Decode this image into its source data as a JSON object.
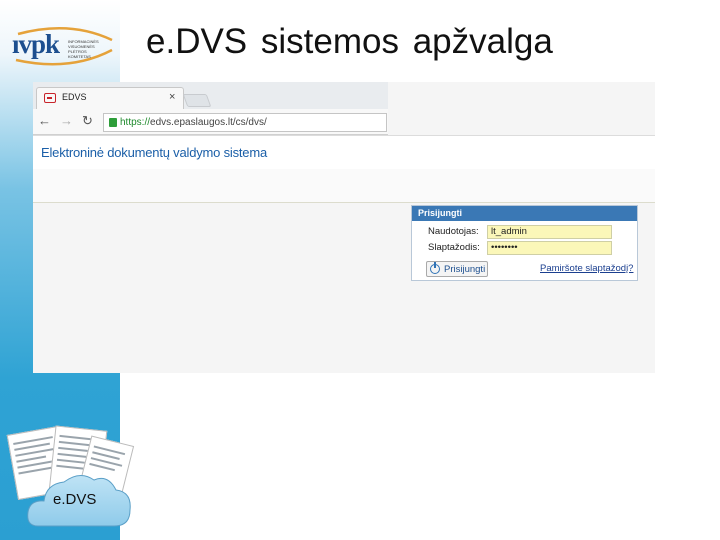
{
  "logo": {
    "text": "ıvpk",
    "subtitle": "INFORMACINĖS VISUOMENĖS PLĖTROS KOMITETAS"
  },
  "slide": {
    "title": "e.DVS  sistemos apžvalga"
  },
  "browser": {
    "tab_title": "EDVS",
    "tab_close": "×",
    "url_scheme": "https://",
    "url_rest": "edvs.epaslaugos.lt/cs/dvs/"
  },
  "app": {
    "title": "Elektroninė dokumentų valdymo sistema"
  },
  "login": {
    "header": "Prisijungti",
    "username_label": "Naudotojas:",
    "username_value": "lt_admin",
    "password_label": "Slaptažodis:",
    "password_value": "••••••••",
    "submit_label": "Prisijungti",
    "forgot_link": "Pamiršote slaptažodį?"
  },
  "cloud": {
    "label": "e.DVS"
  },
  "colors": {
    "sidebar": "#2b9fd2",
    "login_header": "#3a78b5",
    "autofill": "#fbf7b9"
  },
  "icons": [
    "lock-icon",
    "back-arrow-icon",
    "forward-arrow-icon",
    "reload-icon",
    "power-icon",
    "cloud-icon",
    "document-icon"
  ]
}
